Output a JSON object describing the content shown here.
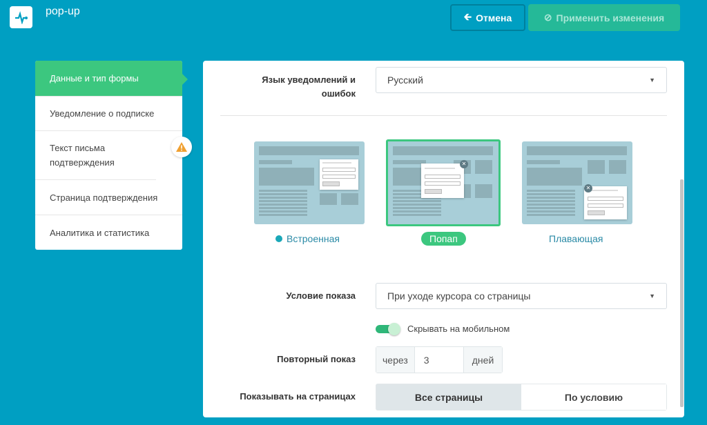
{
  "header": {
    "title": "pop-up",
    "cancel_label": "Отмена",
    "apply_label": "Применить изменения"
  },
  "sidebar": {
    "items": [
      {
        "label": "Данные и тип формы"
      },
      {
        "label": "Уведомление о подписке"
      },
      {
        "label": "Текст письма подтверждения"
      },
      {
        "label": "Страница подтверждения"
      },
      {
        "label": "Аналитика и статистика"
      }
    ]
  },
  "form": {
    "language": {
      "label": "Язык уведомлений и ошибок",
      "value": "Русский"
    },
    "types": [
      {
        "label": "Встроенная"
      },
      {
        "label": "Попап",
        "selected": true
      },
      {
        "label": "Плавающая"
      }
    ],
    "condition": {
      "label": "Условие показа",
      "value": "При уходе курсора со страницы"
    },
    "hide_mobile": {
      "label": "Скрывать на мобильном",
      "on": true
    },
    "repeat": {
      "label": "Повторный показ",
      "prefix": "через",
      "value": "3",
      "suffix": "дней"
    },
    "pages": {
      "label": "Показывать на страницах",
      "options": [
        "Все страницы",
        "По условию"
      ],
      "selected": "Все страницы"
    }
  },
  "colors": {
    "bg": "#009fc2",
    "accent": "#3cc77f"
  }
}
